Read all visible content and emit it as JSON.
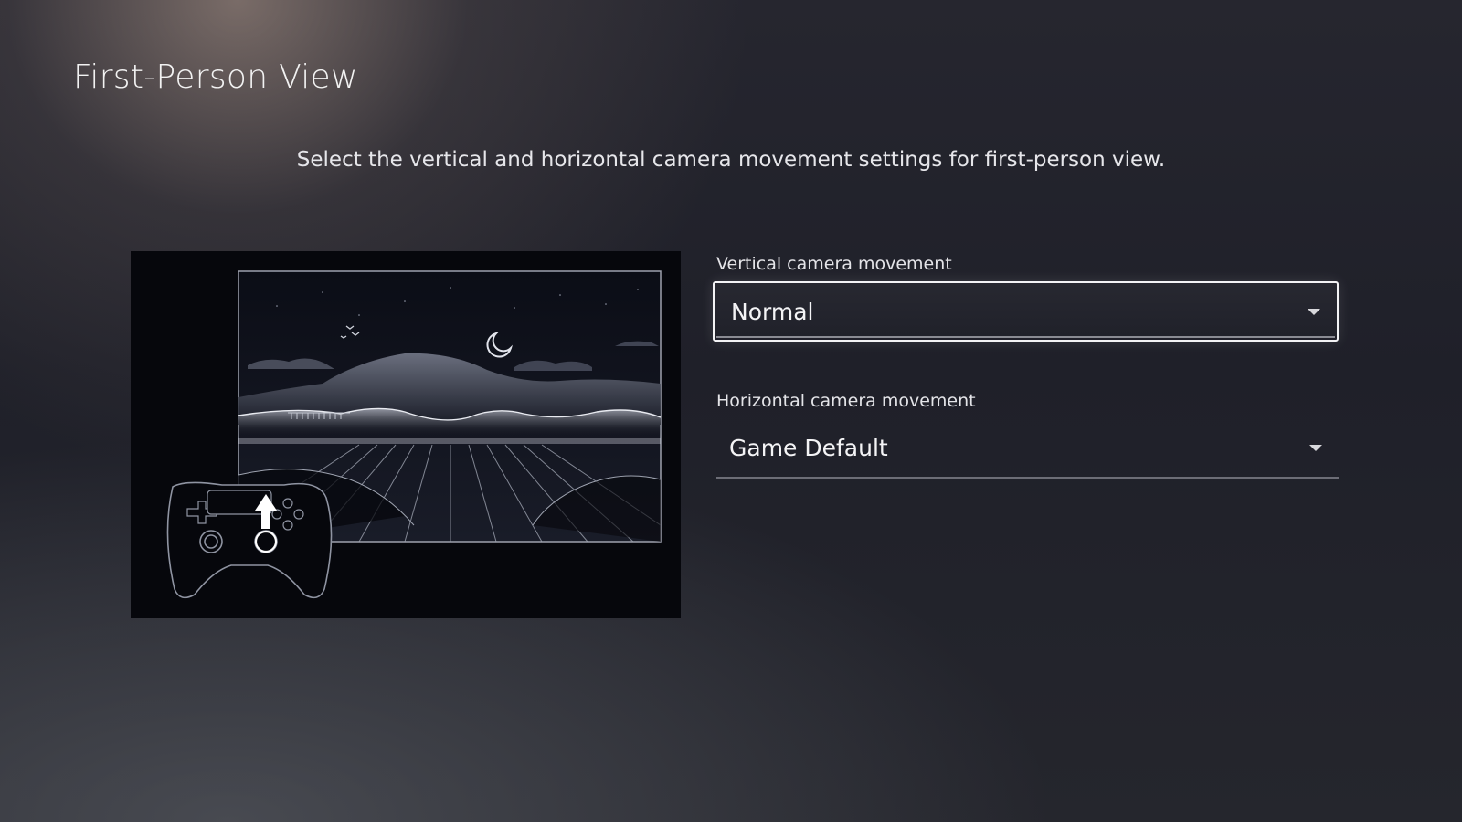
{
  "page": {
    "title": "First-Person View",
    "description": "Select the vertical and horizontal camera movement settings for first-person view."
  },
  "illustration": {
    "scene": "night landscape with moon, birds, mountains and bridge",
    "controller": "controller-icon",
    "arrow": "up-arrow-icon",
    "colors": {
      "background": "#06070c",
      "line": "#c8ccd6"
    }
  },
  "settings": {
    "vertical": {
      "label": "Vertical camera movement",
      "value": "Normal",
      "focused": true,
      "icon": "chevron-down-icon"
    },
    "horizontal": {
      "label": "Horizontal camera movement",
      "value": "Game Default",
      "focused": false,
      "icon": "chevron-down-icon"
    }
  }
}
